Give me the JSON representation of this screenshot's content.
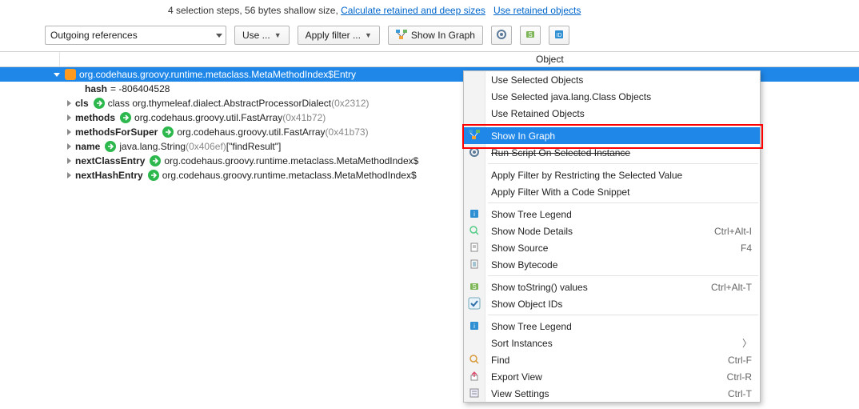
{
  "header": {
    "prefix": "4 selection steps, 56 bytes shallow size,  ",
    "link1": "Calculate retained and deep sizes",
    "link2": "Use retained objects"
  },
  "toolbar": {
    "combo": "Outgoing references",
    "use": "Use ...",
    "apply": "Apply filter ...",
    "show_graph": "Show In Graph"
  },
  "tree": {
    "header": "Object",
    "root": {
      "label": "org.codehaus.groovy.runtime.metaclass.MetaMethodIndex$Entry"
    },
    "hash_label": "hash",
    "hash_value": " =  -806404528",
    "rows": [
      {
        "field": "cls",
        "type": "class org.thymeleaf.dialect.AbstractProcessorDialect",
        "addr": "(0x2312)"
      },
      {
        "field": "methods",
        "type": "org.codehaus.groovy.util.FastArray",
        "addr": "(0x41b72)"
      },
      {
        "field": "methodsForSuper",
        "type": "org.codehaus.groovy.util.FastArray",
        "addr": "(0x41b73)"
      },
      {
        "field": "name",
        "type": "java.lang.String",
        "addr": "(0x406ef)",
        "extra": " [\"findResult\"]"
      },
      {
        "field": "nextClassEntry",
        "type": "org.codehaus.groovy.runtime.metaclass.MetaMethodIndex$",
        "addr": ""
      },
      {
        "field": "nextHashEntry",
        "type": "org.codehaus.groovy.runtime.metaclass.MetaMethodIndex$",
        "addr": ""
      }
    ]
  },
  "menu": {
    "g1": [
      "Use Selected Objects",
      "Use Selected java.lang.Class Objects",
      "Use Retained Objects"
    ],
    "show_graph": "Show In Graph",
    "run_script": "Run Script On Selected Instance",
    "g2": [
      "Apply Filter by Restricting the Selected Value",
      "Apply Filter With a Code Snippet"
    ],
    "g3": [
      {
        "label": "Show Tree Legend"
      },
      {
        "label": "Show Node Details",
        "kb": "Ctrl+Alt-I"
      },
      {
        "label": "Show Source",
        "kb": "F4"
      },
      {
        "label": "Show Bytecode"
      }
    ],
    "g4": [
      {
        "label": "Show toString() values",
        "kb": "Ctrl+Alt-T"
      },
      {
        "label": "Show Object IDs",
        "check": true
      }
    ],
    "g5": [
      {
        "label": "Show Tree Legend"
      },
      {
        "label": "Sort Instances",
        "sub": true
      },
      {
        "label": "Find",
        "kb": "Ctrl-F"
      },
      {
        "label": "Export View",
        "kb": "Ctrl-R"
      },
      {
        "label": "View Settings",
        "kb": "Ctrl-T"
      }
    ]
  }
}
